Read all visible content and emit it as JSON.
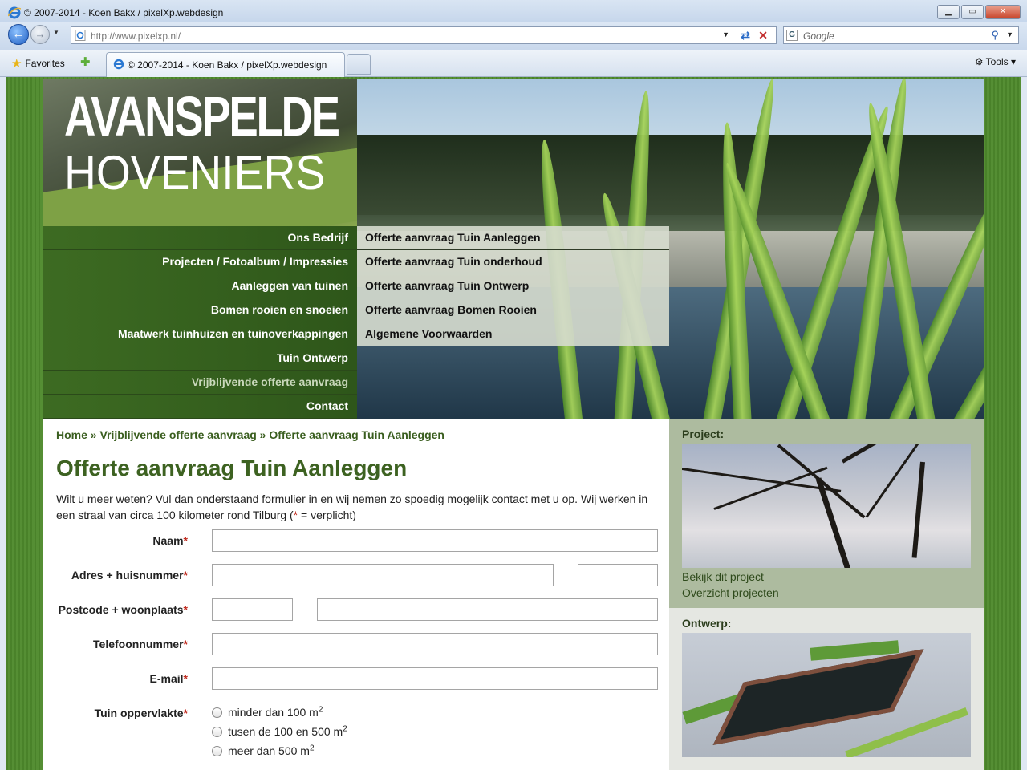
{
  "browser": {
    "window_title": "© 2007-2014 - Koen Bakx / pixelXp.webdesign",
    "url": "http://www.pixelxp.nl/",
    "search_placeholder": "Google",
    "favorites_label": "Favorites",
    "tab_title": "© 2007-2014 - Koen Bakx / pixelXp.webdesign",
    "tools_label": "Tools"
  },
  "site": {
    "logo_line1": "AVANSPELDE",
    "logo_line2": "HOVENIERS",
    "main_nav": [
      {
        "label": "Ons Bedrijf",
        "active": false
      },
      {
        "label": "Projecten / Fotoalbum / Impressies",
        "active": false
      },
      {
        "label": "Aanleggen van tuinen",
        "active": false
      },
      {
        "label": "Bomen rooien en snoeien",
        "active": false
      },
      {
        "label": "Maatwerk tuinhuizen en tuinoverkappingen",
        "active": false
      },
      {
        "label": "Tuin Ontwerp",
        "active": false
      },
      {
        "label": "Vrijblijvende offerte aanvraag",
        "active": true
      },
      {
        "label": "Contact",
        "active": false
      }
    ],
    "sub_nav": [
      {
        "label": "Offerte aanvraag Tuin Aanleggen"
      },
      {
        "label": "Offerte aanvraag Tuin onderhoud"
      },
      {
        "label": "Offerte aanvraag Tuin Ontwerp"
      },
      {
        "label": "Offerte aanvraag Bomen Rooien"
      },
      {
        "label": "Algemene Voorwaarden"
      }
    ]
  },
  "breadcrumb": {
    "home": "Home",
    "sep": " » ",
    "level1": "Vrijblijvende offerte aanvraag",
    "current": "Offerte aanvraag Tuin Aanleggen"
  },
  "page": {
    "title": "Offerte aanvraag Tuin Aanleggen",
    "intro_start": "Wilt u meer weten? Vul dan onderstaand formulier in en wij nemen zo spoedig mogelijk contact met u op. Wij werken in een straal van circa 100 kilometer rond Tilburg (",
    "intro_star": "*",
    "intro_end": " = verplicht)"
  },
  "form": {
    "required_mark": "*",
    "fields": {
      "naam": "Naam",
      "adres": "Adres + huisnummer",
      "postcode": "Postcode + woonplaats",
      "telefoon": "Telefoonnummer",
      "email": "E-mail",
      "oppervlakte": "Tuin oppervlakte"
    },
    "values": {
      "naam": "",
      "adres": "",
      "huisnummer": "",
      "postcode": "",
      "woonplaats": "",
      "telefoon": "",
      "email": ""
    },
    "area_options": [
      {
        "text": "minder dan 100 m",
        "sup": "2"
      },
      {
        "text": "tusen de 100 en 500 m",
        "sup": "2"
      },
      {
        "text": "meer dan 500 m",
        "sup": "2"
      }
    ]
  },
  "sidebar": {
    "project_heading": "Project:",
    "project_link1": "Bekijk dit project",
    "project_link2": "Overzicht projecten",
    "ontwerp_heading": "Ontwerp:"
  },
  "colors": {
    "site_green": "#3d6221",
    "nav_green": "#2e561a",
    "required_red": "#c0281c",
    "sidebar_panel": "#adbb9f"
  }
}
